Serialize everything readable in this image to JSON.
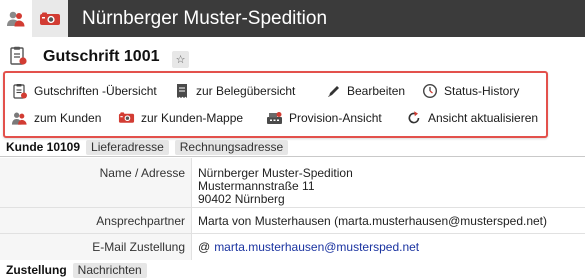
{
  "topbar": {
    "title": "Nürnberger Muster-Spedition",
    "tabs": [
      {
        "icon": "users-icon",
        "active": true
      },
      {
        "icon": "camera-icon",
        "active": false
      }
    ]
  },
  "header": {
    "title": "Gutschrift 1001",
    "star": "☆"
  },
  "actions": [
    {
      "label": "Gutschriften -Übersicht",
      "icon": "document-list-icon"
    },
    {
      "label": "zur Belegübersicht",
      "icon": "receipt-icon"
    },
    {
      "label": "Bearbeiten",
      "icon": "pen-icon"
    },
    {
      "label": "Status-History",
      "icon": "clock-icon"
    },
    {
      "label": "zum Kunden",
      "icon": "users-icon"
    },
    {
      "label": "zur Kunden-Mappe",
      "icon": "folder-camera-icon"
    },
    {
      "label": "Provision-Ansicht",
      "icon": "cashbox-icon"
    },
    {
      "label": "Ansicht aktualisieren",
      "icon": "refresh-icon"
    }
  ],
  "kunde": {
    "label": "Kunde 10109",
    "tabs": [
      "Lieferadresse",
      "Rechnungsadresse"
    ]
  },
  "fields": {
    "name_key": "Name / Adresse",
    "name_lines": [
      "Nürnberger Muster-Spedition",
      "Mustermannstraße 11",
      "90402 Nürnberg"
    ],
    "contact_key": "Ansprechpartner",
    "contact_value": "Marta von Musterhausen (marta.musterhausen@mustersped.net)",
    "email_key": "E-Mail Zustellung",
    "email_at": "@",
    "email_value": "marta.musterhausen@mustersped.net"
  },
  "zustellung": {
    "label": "Zustellung",
    "tabs": [
      "Nachrichten"
    ]
  },
  "colors": {
    "topbar": "#3b3b3b",
    "highlight_border": "#e3514c",
    "link": "#1a33a0",
    "icon_red": "#d23c33"
  }
}
